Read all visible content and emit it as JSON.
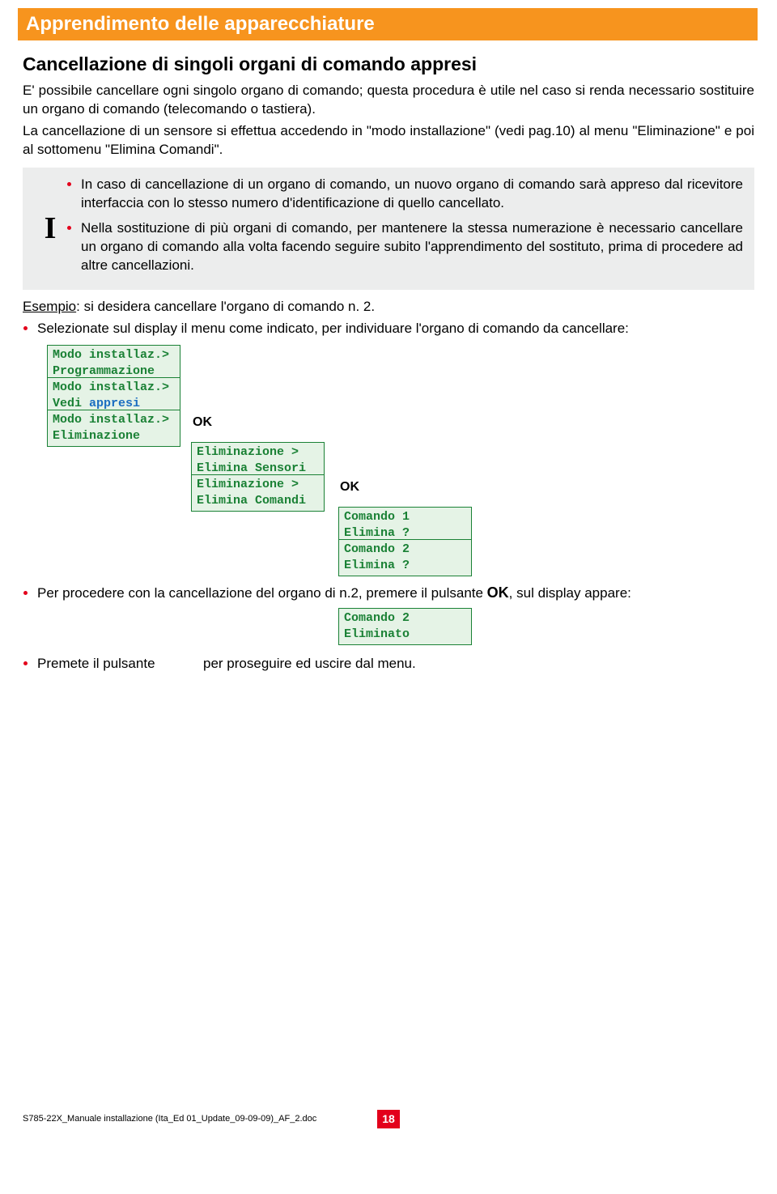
{
  "header": {
    "bar": "Apprendimento delle apparecchiature"
  },
  "main": {
    "title": "Cancellazione di singoli organi di comando appresi",
    "para1": "E' possibile cancellare ogni singolo organo di comando; questa procedura è utile nel caso si renda necessario sostituire un organo di comando (telecomando o tastiera).",
    "para2": "La cancellazione di un sensore si effettua accedendo in \"modo installazione\" (vedi pag.10) al menu \"Eliminazione\" e poi al sottomenu \"Elimina Comandi\"."
  },
  "note": {
    "icon": "I",
    "item1": "In caso di cancellazione di un organo di comando, un nuovo organo di comando sarà appreso dal ricevitore interfaccia con lo stesso numero d'identificazione di quello cancellato.",
    "item2": "Nella sostituzione di più organi di comando, per mantenere la stessa numerazione è necessario cancellare un organo di comando alla volta facendo seguire subito l'apprendimento del sostituto, prima di procedere ad altre cancellazioni."
  },
  "example": {
    "label": "Esempio",
    "text": ": si desidera cancellare l'organo di comando n. 2.",
    "bullet1": "Selezionate sul display il menu come indicato, per individuare l'organo di comando da cancellare:"
  },
  "menu": {
    "col1": {
      "m1a": "Modo installaz.>",
      "m1b": "Programmazione",
      "m2a": "Modo installaz.>",
      "m2b_pre": "Vedi ",
      "m2b_blue": "appresi",
      "m3a": "Modo installaz.>",
      "m3b": "Eliminazione"
    },
    "ok1": "OK",
    "col2": {
      "m1a": "Eliminazione   >",
      "m1b": "Elimina Sensori",
      "m2a": "Eliminazione   >",
      "m2b": "Elimina Comandi"
    },
    "ok2": "OK",
    "col3": {
      "m1a": "Comando       1",
      "m1b": "Elimina ?",
      "m2a": "Comando       2",
      "m2b": "Elimina ?"
    }
  },
  "step2": {
    "pre": "Per procedere con la cancellazione del organo di n.2, premere il pulsante ",
    "ok": "OK",
    "post": ", sul display appare:",
    "box_a": "Comando       2",
    "box_b": "Eliminato"
  },
  "step3": {
    "pre": "Premete il pulsante",
    "post": "per proseguire ed uscire dal menu."
  },
  "footer": {
    "doc": "S785-22X_Manuale installazione (Ita_Ed 01_Update_09-09-09)_AF_2.doc",
    "page": "18"
  }
}
